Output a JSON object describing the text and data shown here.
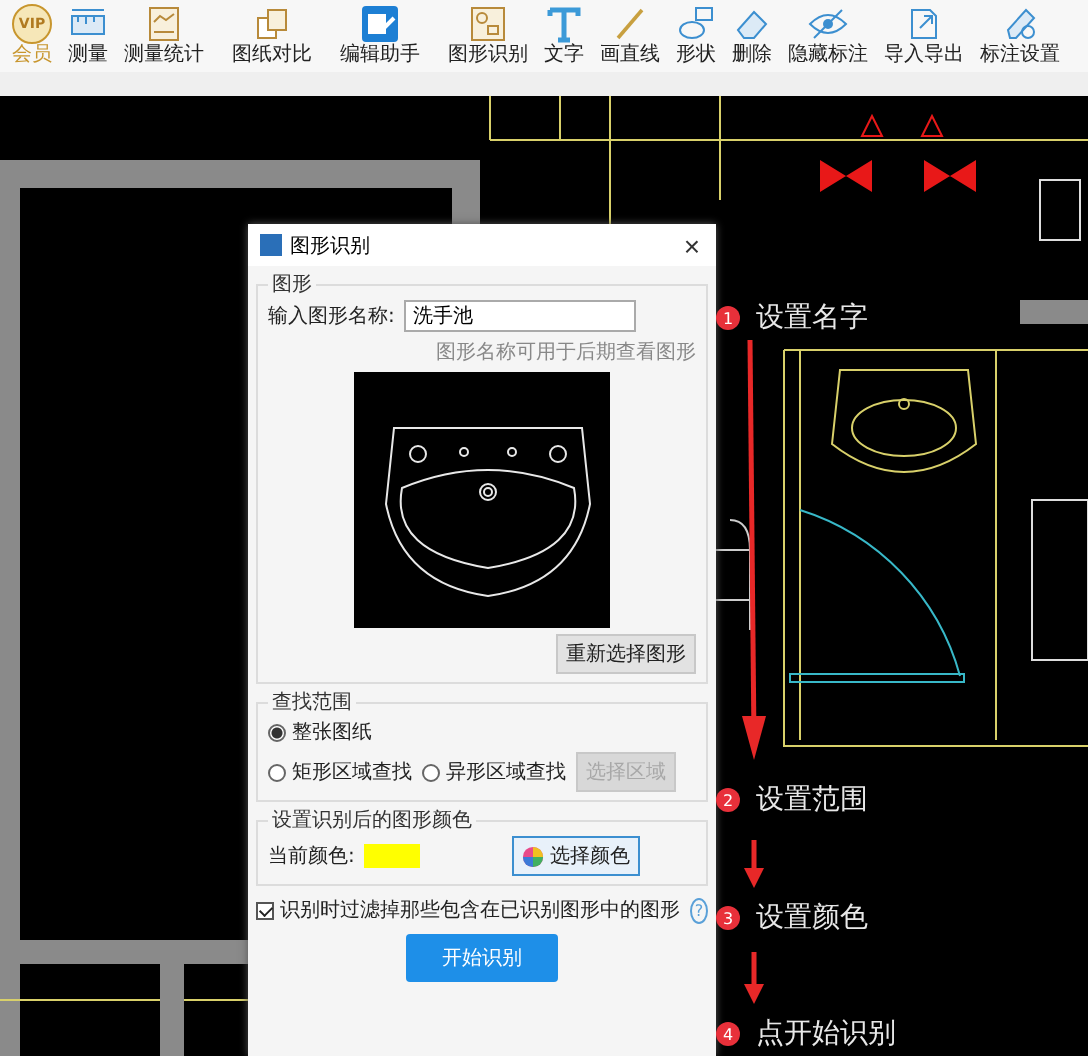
{
  "toolbar": {
    "items": [
      {
        "label": "会员",
        "icon_text": "VIP"
      },
      {
        "label": "测量"
      },
      {
        "label": "测量统计"
      },
      {
        "label": "图纸对比"
      },
      {
        "label": "编辑助手"
      },
      {
        "label": "图形识别"
      },
      {
        "label": "文字"
      },
      {
        "label": "画直线"
      },
      {
        "label": "形状"
      },
      {
        "label": "删除"
      },
      {
        "label": "隐藏标注"
      },
      {
        "label": "导入导出"
      },
      {
        "label": "标注设置"
      }
    ]
  },
  "dialog": {
    "title": "图形识别",
    "close": "×",
    "shape_group": {
      "legend": "图形",
      "name_label": "输入图形名称:",
      "name_value": "洗手池",
      "hint": "图形名称可用于后期查看图形",
      "reselect_button": "重新选择图形"
    },
    "range_group": {
      "legend": "查找范围",
      "options": [
        {
          "label": "整张图纸",
          "selected": true
        },
        {
          "label": "矩形区域查找",
          "selected": false
        },
        {
          "label": "异形区域查找",
          "selected": false
        }
      ],
      "area_button": {
        "label": "选择区域",
        "disabled": true
      }
    },
    "color_group": {
      "legend": "设置识别后的图形颜色",
      "current_label": "当前颜色:",
      "color": "#ffff00",
      "choose_button": "选择颜色"
    },
    "filter": {
      "label": "识别时过滤掉那些包含在已识别图形中的图形",
      "checked": true,
      "help": "?"
    },
    "start_button": "开始识别"
  },
  "steps": [
    {
      "number": "1",
      "label": "设置名字",
      "color": "#e8303a"
    },
    {
      "number": "2",
      "label": "设置范围",
      "color": "#e8303a"
    },
    {
      "number": "3",
      "label": "设置颜色",
      "color": "#e8303a"
    },
    {
      "number": "4",
      "label": "点开始识别",
      "color": "#e8303a"
    }
  ]
}
